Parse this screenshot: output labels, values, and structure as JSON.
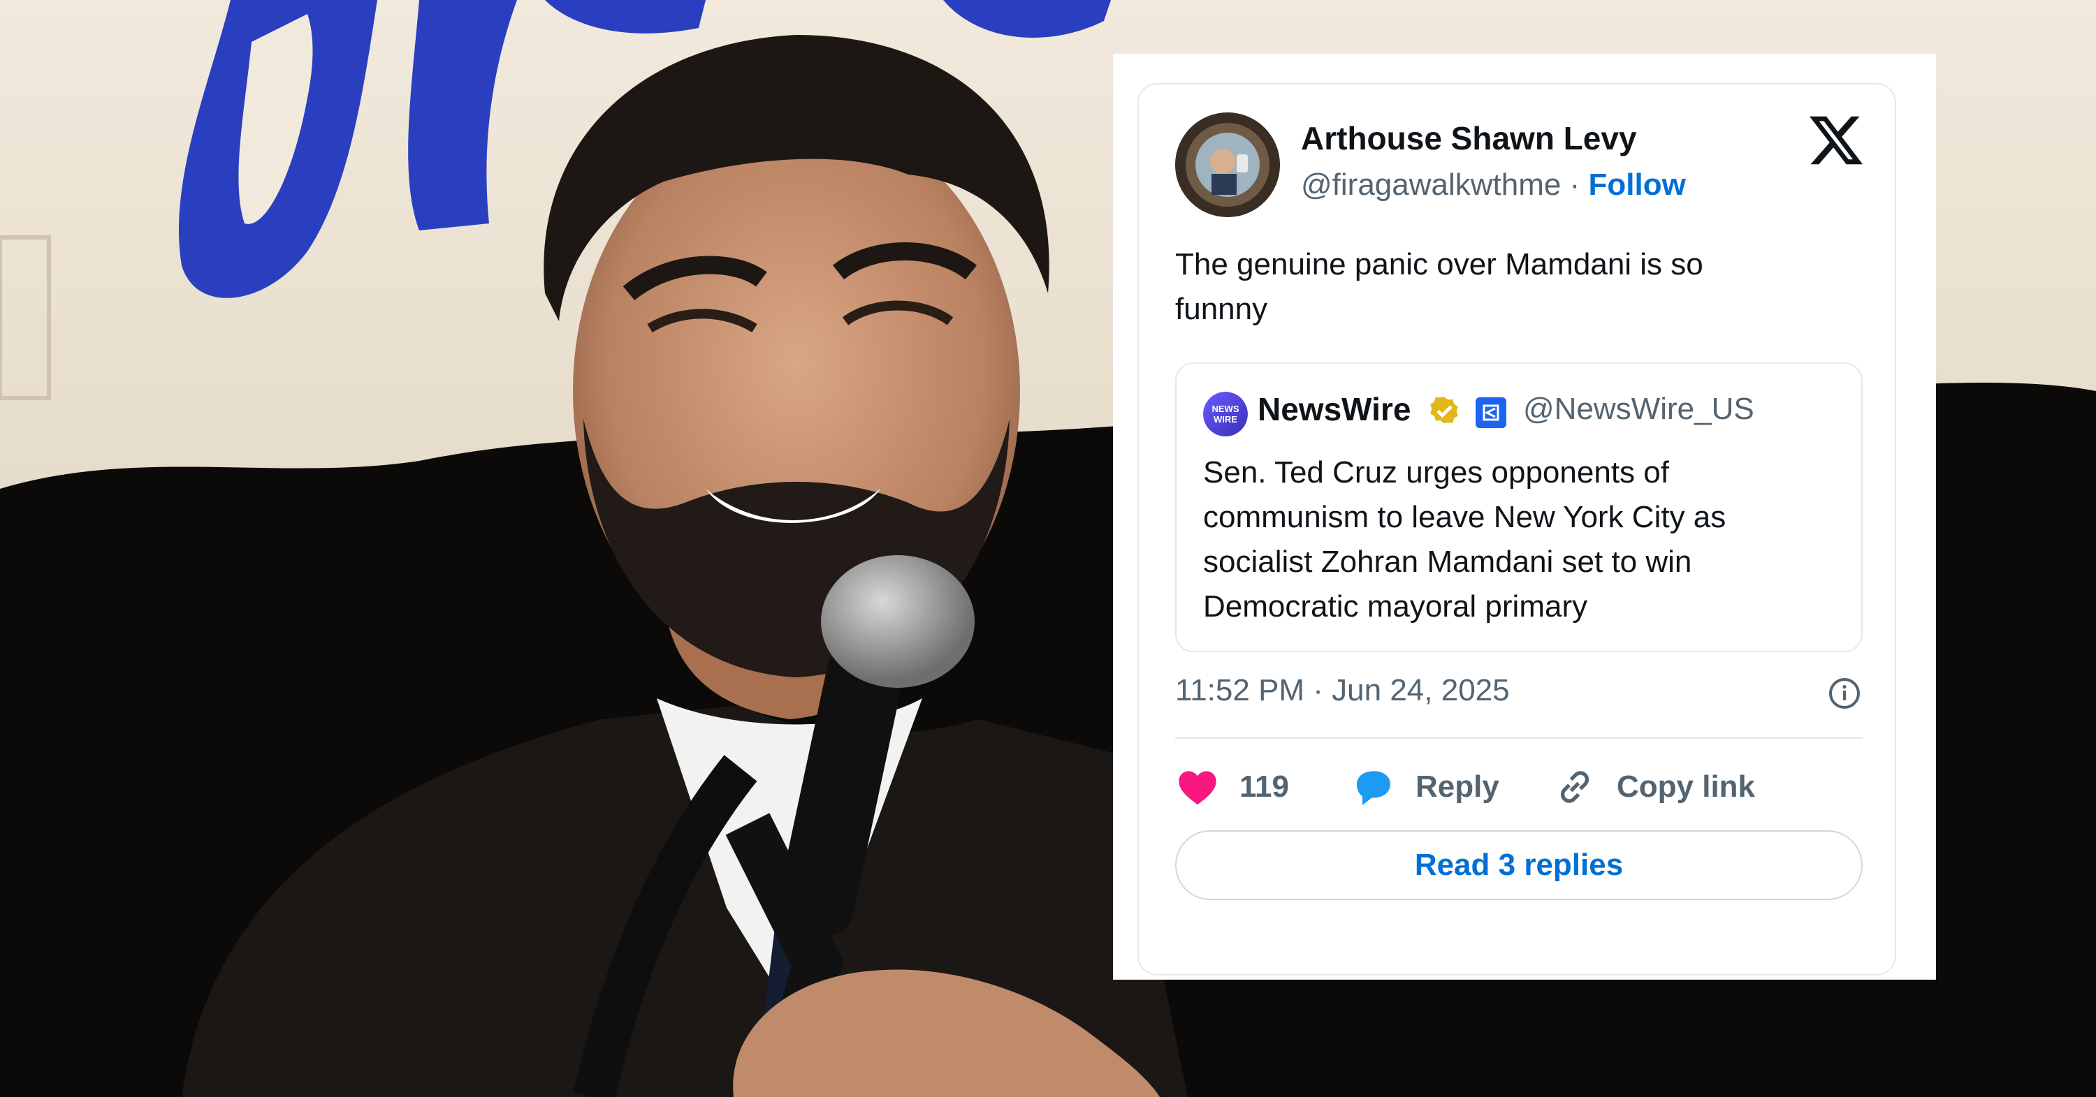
{
  "tweet": {
    "author_name": "Arthouse Shawn Levy",
    "handle": "@firagawalkwthme",
    "separator": "·",
    "follow_label": "Follow",
    "text": "The genuine panic over Mamdani is so funnny",
    "timestamp": "11:52 PM · Jun 24, 2025",
    "likes": "119",
    "reply_label": "Reply",
    "copy_label": "Copy link",
    "read_replies_label": "Read 3 replies"
  },
  "quote": {
    "name": "NewsWire",
    "handle": "@NewsWire_US",
    "text": "Sen. Ted Cruz urges opponents of communism to leave New York City as socialist Zohran Mamdani set to win Democratic mayoral primary",
    "avatar_label": "NEWS WIRE"
  },
  "icons": {
    "brand": "x-logo-icon",
    "verified": "verified-badge-icon",
    "affiliate": "affiliate-badge-icon",
    "info": "info-icon",
    "like": "heart-icon",
    "reply": "reply-bubble-icon",
    "copy": "link-icon"
  },
  "colors": {
    "link_blue": "#006fd6",
    "like_pink": "#f91880",
    "reply_blue": "#1d9bf0",
    "text_primary": "#0f1419",
    "text_secondary": "#536471",
    "verified_gold": "#e2b719"
  }
}
